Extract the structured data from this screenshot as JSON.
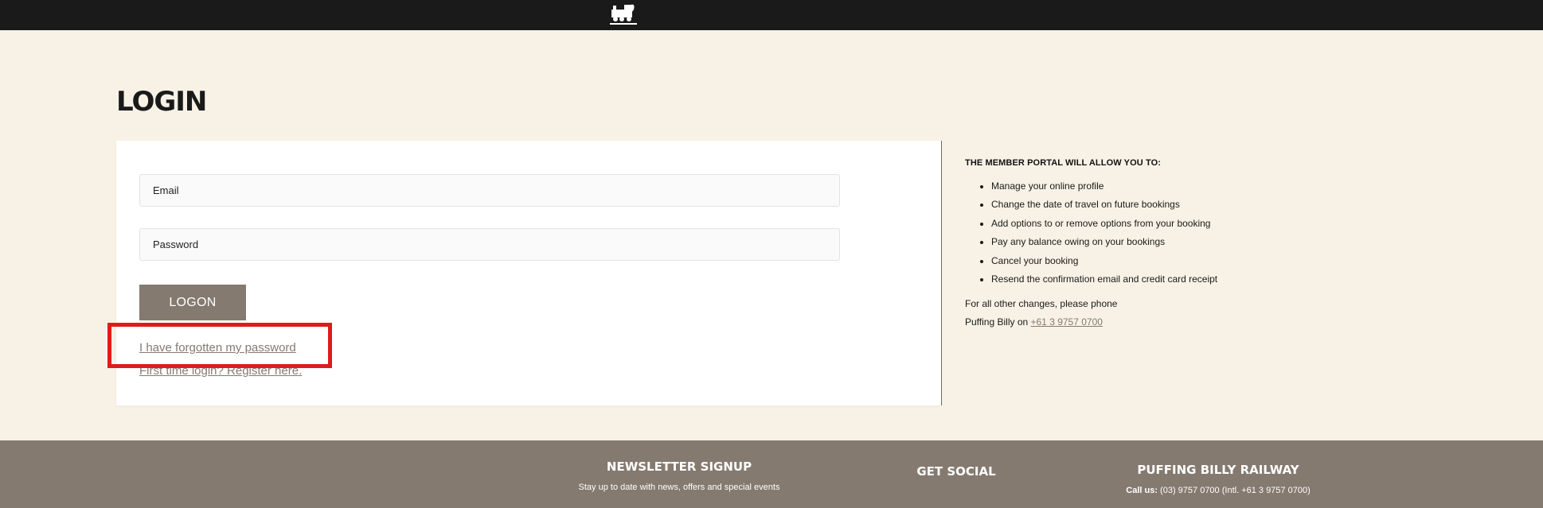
{
  "header": {
    "logo_icon": "steam-train-logo-icon"
  },
  "page": {
    "title": "LOGIN"
  },
  "form": {
    "email_placeholder": "Email",
    "password_placeholder": "Password",
    "logon_label": "LOGON",
    "forgot_link": "I have forgotten my password",
    "register_link": "First time login? Register here."
  },
  "info": {
    "heading": "THE MEMBER PORTAL WILL ALLOW YOU TO:",
    "items": [
      "Manage your online profile",
      "Change the date of travel on future bookings",
      "Add options to or remove options from your booking",
      "Pay any balance owing on your bookings",
      "Cancel your booking",
      "Resend the confirmation email and credit card receipt"
    ],
    "note_line1": "For all other changes, please phone",
    "note_line2_prefix": "Puffing Billy on ",
    "phone": "+61 3 9757 0700"
  },
  "footer": {
    "newsletter_heading": "NEWSLETTER SIGNUP",
    "newsletter_text": "Stay up to date with news, offers and special events",
    "social_heading": "GET SOCIAL",
    "railway_heading": "PUFFING BILLY RAILWAY",
    "call_label": "Call us:",
    "call_text": " (03) 9757 0700 (Intl. +61 3 9757 0700)"
  },
  "colors": {
    "topbar": "#1a1a1a",
    "page_bg": "#f8f2e6",
    "accent": "#857a70",
    "highlight": "#e01b1b"
  }
}
